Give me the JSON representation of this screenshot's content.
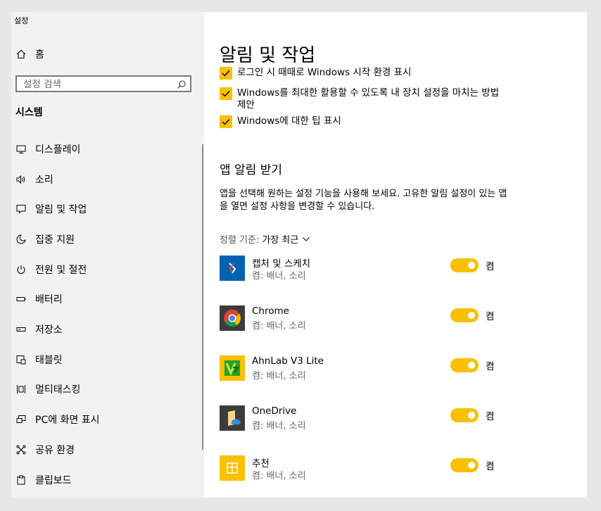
{
  "window": {
    "title": "설정"
  },
  "sidebar": {
    "home_label": "홈",
    "search_placeholder": "설정 검색",
    "section_title": "시스템",
    "items": [
      {
        "label": "디스플레이",
        "icon": "monitor-icon"
      },
      {
        "label": "소리",
        "icon": "speaker-icon"
      },
      {
        "label": "알림 및 작업",
        "icon": "message-icon"
      },
      {
        "label": "집중 지원",
        "icon": "moon-icon"
      },
      {
        "label": "전원 및 절전",
        "icon": "power-icon"
      },
      {
        "label": "배터리",
        "icon": "battery-icon"
      },
      {
        "label": "저장소",
        "icon": "storage-icon"
      },
      {
        "label": "태블릿",
        "icon": "tablet-icon"
      },
      {
        "label": "멀티태스킹",
        "icon": "multitasking-icon"
      },
      {
        "label": "PC에 화면 표시",
        "icon": "project-icon"
      },
      {
        "label": "공유 환경",
        "icon": "share-icon"
      },
      {
        "label": "클립보드",
        "icon": "clipboard-icon"
      }
    ]
  },
  "main": {
    "title": "알림 및 작업",
    "checkboxes": [
      {
        "label": "로그인 시 때때로 Windows 시작 환경 표시",
        "checked": true
      },
      {
        "label": "Windows를 최대한 활용할 수 있도록 내 장치 설정을 마치는 방법 제안",
        "checked": true
      },
      {
        "label": "Windows에 대한 팁 표시",
        "checked": true
      }
    ],
    "app_section_title": "앱 알림 받기",
    "app_section_desc": "앱을 선택해 원하는 설정 기능을 사용해 보세요. 고유한 알림 설정이 있는 앱을 열면 설정 사항을 변경할 수 있습니다.",
    "sort_key": "정렬 기준:",
    "sort_value": "가장 최근",
    "apps": [
      {
        "name": "캡처 및 스케치",
        "sub": "켬: 배너, 소리",
        "state": "켬",
        "icon": "snip-sketch-icon"
      },
      {
        "name": "Chrome",
        "sub": "켬: 배너, 소리",
        "state": "켬",
        "icon": "chrome-icon"
      },
      {
        "name": "AhnLab V3 Lite",
        "sub": "켬: 배너, 소리",
        "state": "켬",
        "icon": "ahnlab-icon"
      },
      {
        "name": "OneDrive",
        "sub": "켬: 배너, 소리",
        "state": "켬",
        "icon": "onedrive-icon"
      },
      {
        "name": "추천",
        "sub": "켬: 배너, 소리",
        "state": "켬",
        "icon": "suggestions-icon"
      }
    ]
  },
  "colors": {
    "accent": "#f9c000",
    "sidebar_bg": "#f2f2f2"
  }
}
